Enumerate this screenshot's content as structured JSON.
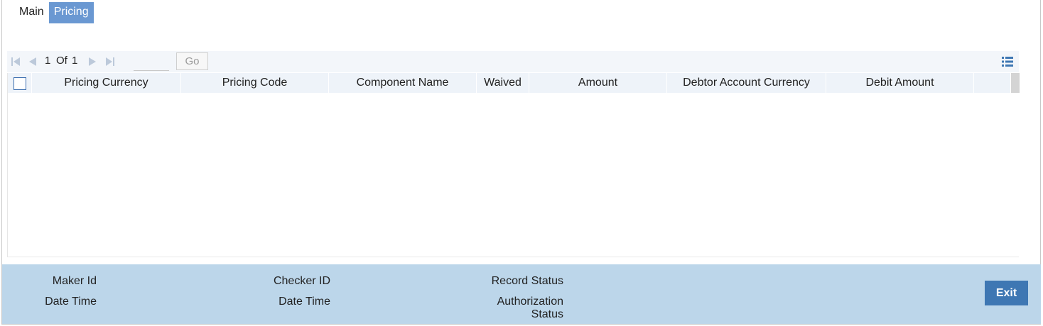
{
  "tabs": [
    {
      "label": "Main",
      "active": false
    },
    {
      "label": "Pricing",
      "active": true
    }
  ],
  "pagination": {
    "current": "1",
    "of_label": "Of",
    "total": "1",
    "page_input_value": "",
    "go_label": "Go"
  },
  "grid": {
    "columns": [
      "Pricing Currency",
      "Pricing Code",
      "Component Name",
      "Waived",
      "Amount",
      "Debtor Account Currency",
      "Debit Amount"
    ],
    "rows": []
  },
  "footer": {
    "maker_id": "Maker Id",
    "maker_date_time": "Date Time",
    "checker_id": "Checker ID",
    "checker_date_time": "Date Time",
    "record_status": "Record Status",
    "authorization_status_line1": "Authorization",
    "authorization_status_line2": "Status",
    "exit_label": "Exit"
  },
  "colors": {
    "active_tab": "#6a98d2",
    "footer_bg": "#bcd6ea",
    "exit_button": "#3e77b3",
    "header_bg": "#eef3f9"
  },
  "icons": [
    "first-page-icon",
    "previous-page-icon",
    "next-page-icon",
    "last-page-icon",
    "column-menu-icon"
  ]
}
